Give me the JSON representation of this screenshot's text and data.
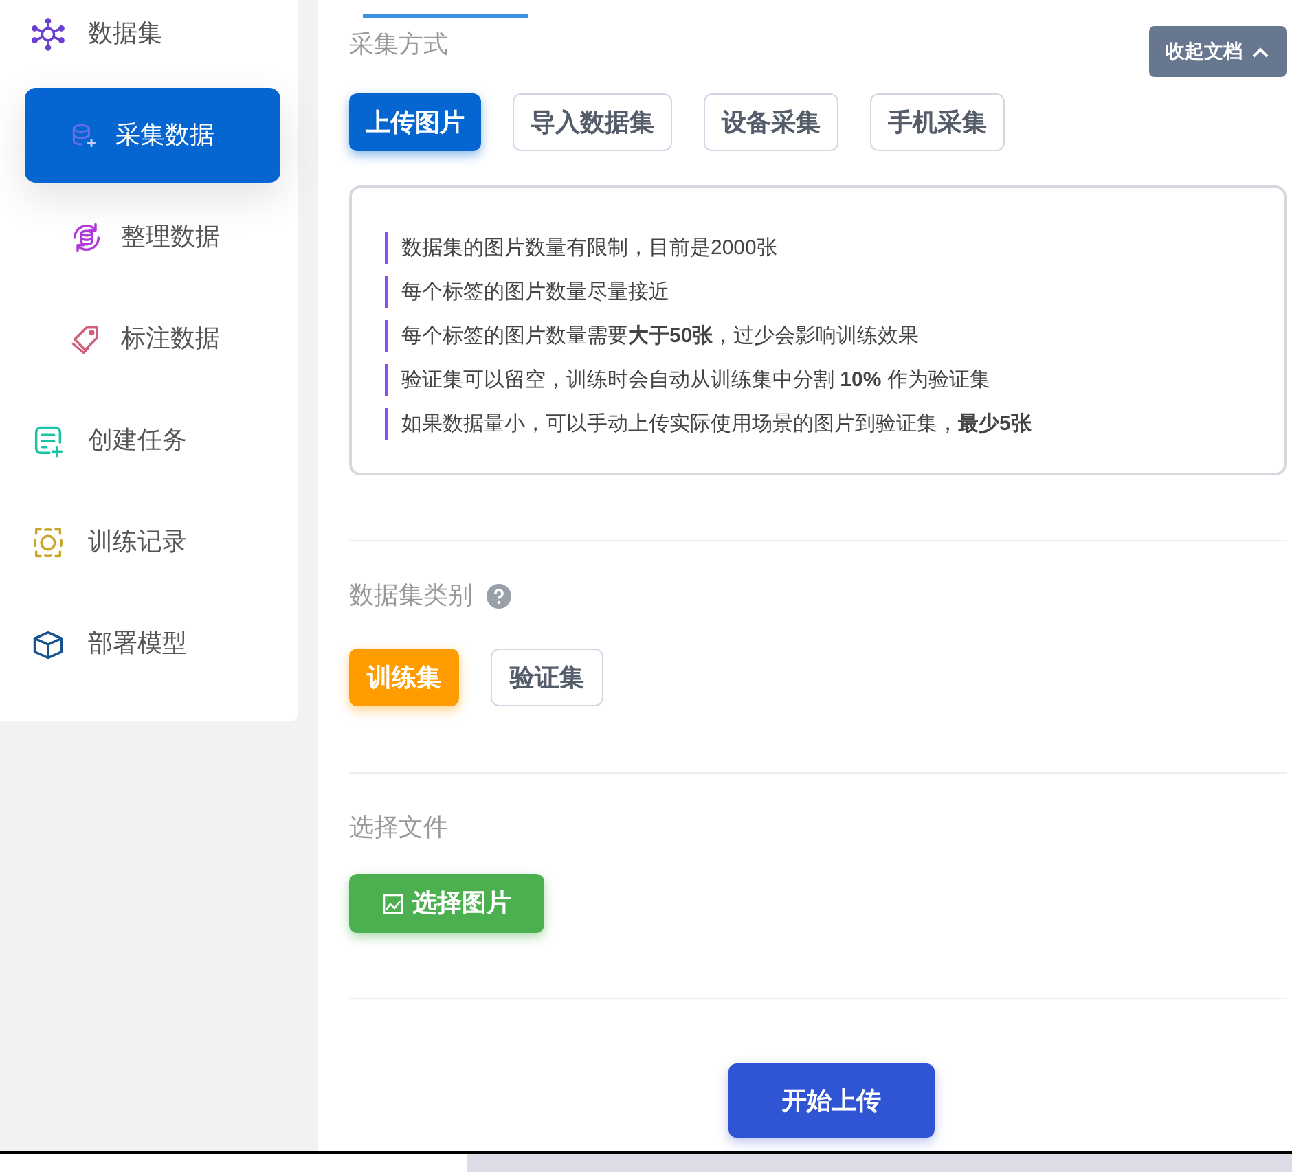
{
  "sidebar": {
    "items": [
      {
        "label": "数据集",
        "selected": false,
        "children": [
          {
            "label": "采集数据",
            "selected": true
          },
          {
            "label": "整理数据",
            "selected": false
          },
          {
            "label": "标注数据",
            "selected": false
          }
        ]
      },
      {
        "label": "创建任务",
        "selected": false
      },
      {
        "label": "训练记录",
        "selected": false
      },
      {
        "label": "部署模型",
        "selected": false
      }
    ]
  },
  "collapse_docs_button": {
    "label": "收起文档",
    "expanded": true
  },
  "method": {
    "title": "采集方式",
    "options": [
      {
        "label": "上传图片",
        "selected": true
      },
      {
        "label": "导入数据集",
        "selected": false
      },
      {
        "label": "设备采集",
        "selected": false
      },
      {
        "label": "手机采集",
        "selected": false
      }
    ]
  },
  "notes": [
    "数据集的图片数量有限制，目前是2000张",
    "每个标签的图片数量尽量接近",
    "每个标签的图片数量需要**大于50张**，过少会影响训练效果",
    "验证集可以留空，训练时会自动从训练集中分割 **10%** 作为验证集",
    "如果数据量小，可以手动上传实际使用场景的图片到验证集，**最少5张**"
  ],
  "category": {
    "title": "数据集类别",
    "options": [
      {
        "label": "训练集",
        "selected": true
      },
      {
        "label": "验证集",
        "selected": false
      }
    ]
  },
  "file": {
    "title": "选择文件",
    "button": "选择图片"
  },
  "start_button": "开始上传"
}
